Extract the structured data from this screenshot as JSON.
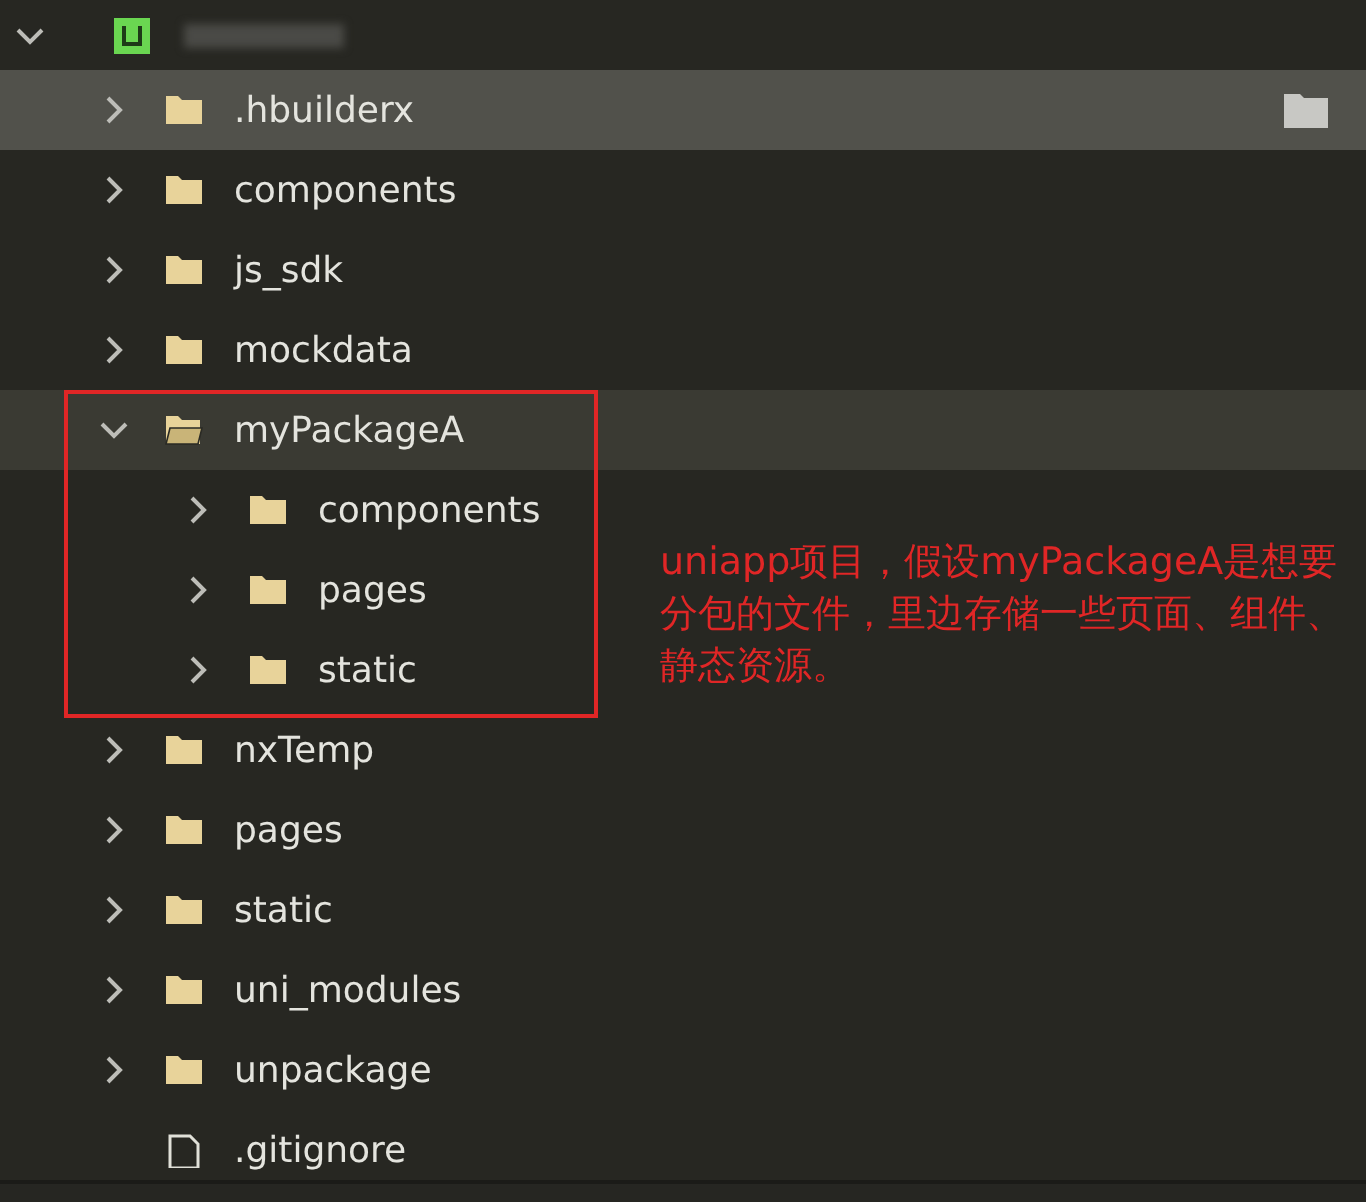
{
  "project": {
    "expanded": true
  },
  "tree": [
    {
      "kind": "folder",
      "name": ".hbuilderx",
      "expanded": false,
      "selected": false,
      "hovered": true
    },
    {
      "kind": "folder",
      "name": "components",
      "expanded": false,
      "selected": false,
      "hovered": false
    },
    {
      "kind": "folder",
      "name": "js_sdk",
      "expanded": false,
      "selected": false,
      "hovered": false
    },
    {
      "kind": "folder",
      "name": "mockdata",
      "expanded": false,
      "selected": false,
      "hovered": false
    },
    {
      "kind": "folder",
      "name": "myPackageA",
      "expanded": true,
      "selected": true,
      "hovered": false,
      "children": [
        {
          "kind": "folder",
          "name": "components",
          "expanded": false,
          "selected": false,
          "hovered": false
        },
        {
          "kind": "folder",
          "name": "pages",
          "expanded": false,
          "selected": false,
          "hovered": false
        },
        {
          "kind": "folder",
          "name": "static",
          "expanded": false,
          "selected": false,
          "hovered": false
        }
      ]
    },
    {
      "kind": "folder",
      "name": "nxTemp",
      "expanded": false,
      "selected": false,
      "hovered": false
    },
    {
      "kind": "folder",
      "name": "pages",
      "expanded": false,
      "selected": false,
      "hovered": false
    },
    {
      "kind": "folder",
      "name": "static",
      "expanded": false,
      "selected": false,
      "hovered": false
    },
    {
      "kind": "folder",
      "name": "uni_modules",
      "expanded": false,
      "selected": false,
      "hovered": false
    },
    {
      "kind": "folder",
      "name": "unpackage",
      "expanded": false,
      "selected": false,
      "hovered": false
    },
    {
      "kind": "file",
      "name": ".gitignore",
      "selected": false,
      "hovered": false
    }
  ],
  "annotation": {
    "text": "uniapp项目，假设myPackageA是想要分包的文件，里边存储一些页面、组件、静态资源。"
  }
}
